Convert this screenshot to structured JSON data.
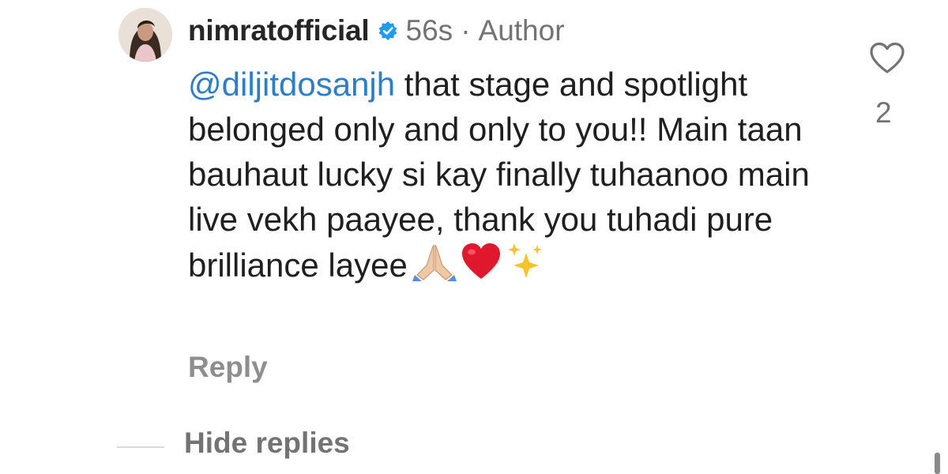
{
  "comment": {
    "username": "nimratofficial",
    "verified_icon": "verified-badge-icon",
    "time": "56s",
    "separator": "·",
    "author_label": "Author",
    "mention": "@diljitdosanjh",
    "text": " that stage and spotlight belonged only and only to you!! Main taan bauhaut lucky si kay finally tuhaanoo main live vekh paayee, thank you tuhadi pure brilliance layee",
    "emojis": [
      "folded-hands-icon",
      "red-heart-icon",
      "sparkles-icon"
    ],
    "reply_label": "Reply",
    "like_icon": "heart-outline-icon",
    "like_count": "2"
  },
  "replies": {
    "hide_label": "Hide replies"
  },
  "colors": {
    "mention": "#2d7dc9",
    "verified": "#1d9bf0",
    "muted": "#737373",
    "text": "#1f1f1f"
  }
}
